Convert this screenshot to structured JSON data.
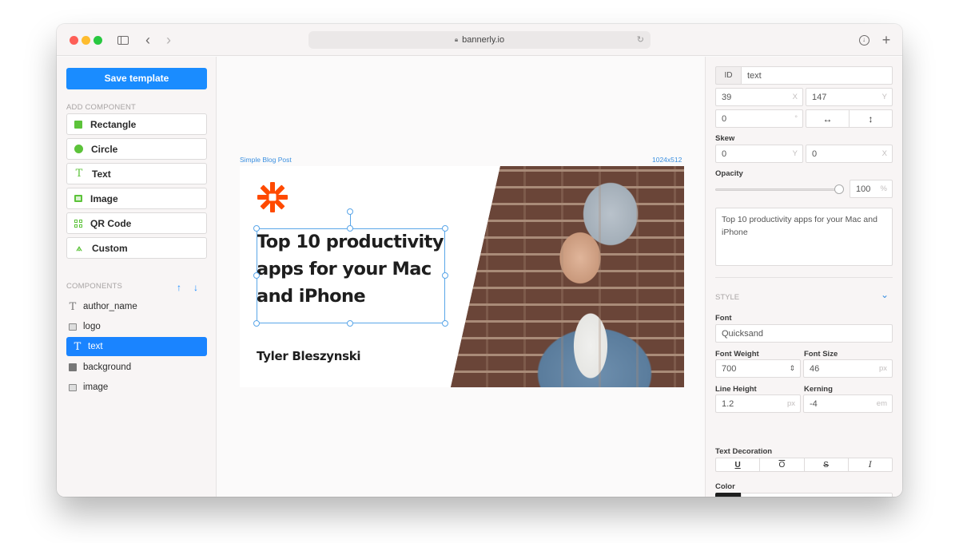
{
  "browser": {
    "url": "bannerly.io"
  },
  "left_panel": {
    "save_label": "Save template",
    "add_component_label": "ADD COMPONENT",
    "add_components": [
      {
        "label": "Rectangle",
        "icon": "rectangle-icon"
      },
      {
        "label": "Circle",
        "icon": "circle-icon"
      },
      {
        "label": "Text",
        "icon": "text-icon"
      },
      {
        "label": "Image",
        "icon": "image-icon"
      },
      {
        "label": "QR Code",
        "icon": "qr-code-icon"
      },
      {
        "label": "Custom",
        "icon": "custom-icon"
      }
    ],
    "components_label": "COMPONENTS",
    "components": [
      {
        "label": "author_name",
        "icon": "text-icon"
      },
      {
        "label": "logo",
        "icon": "image-icon"
      },
      {
        "label": "text",
        "icon": "text-icon",
        "selected": true
      },
      {
        "label": "background",
        "icon": "rectangle-icon"
      },
      {
        "label": "image",
        "icon": "image-icon"
      }
    ]
  },
  "canvas": {
    "template_name": "Simple Blog Post",
    "dimensions": "1024x512",
    "headline": "Top 10 productivity apps for your Mac and iPhone",
    "author": "Tyler Bleszynski",
    "logo_color": "#ff4a00"
  },
  "properties": {
    "id_label": "ID",
    "id_value": "text",
    "x_value": "39",
    "x_unit": "X",
    "y_value": "147",
    "y_unit": "Y",
    "rotation_value": "0",
    "rotation_unit": "°",
    "flip_horizontal_icon": "↔",
    "flip_vertical_icon": "↕",
    "skew_label": "Skew",
    "skew_y_value": "0",
    "skew_y_unit": "Y",
    "skew_x_value": "0",
    "skew_x_unit": "X",
    "opacity_label": "Opacity",
    "opacity_value": "100",
    "opacity_unit": "%",
    "text_content": "Top 10 productivity apps for your Mac and iPhone",
    "style_label": "STYLE",
    "font_label": "Font",
    "font_value": "Quicksand",
    "font_weight_label": "Font Weight",
    "font_weight_value": "700",
    "font_size_label": "Font Size",
    "font_size_value": "46",
    "font_size_unit": "px",
    "line_height_label": "Line Height",
    "line_height_value": "1.2",
    "line_height_unit": "px",
    "kerning_label": "Kerning",
    "kerning_value": "-4",
    "kerning_unit": "em",
    "text_decoration_label": "Text Decoration",
    "decorations": {
      "underline": "U",
      "overline": "O",
      "strikethrough": "S",
      "italic": "I"
    },
    "color_label": "Color",
    "color_value": "rgba(30,30,30, 1)",
    "color_hex": "#1e1e1e"
  },
  "colors": {
    "accent": "#1a8cff",
    "component_icon": "#5cc33a",
    "selection": "#5aa6e8"
  }
}
